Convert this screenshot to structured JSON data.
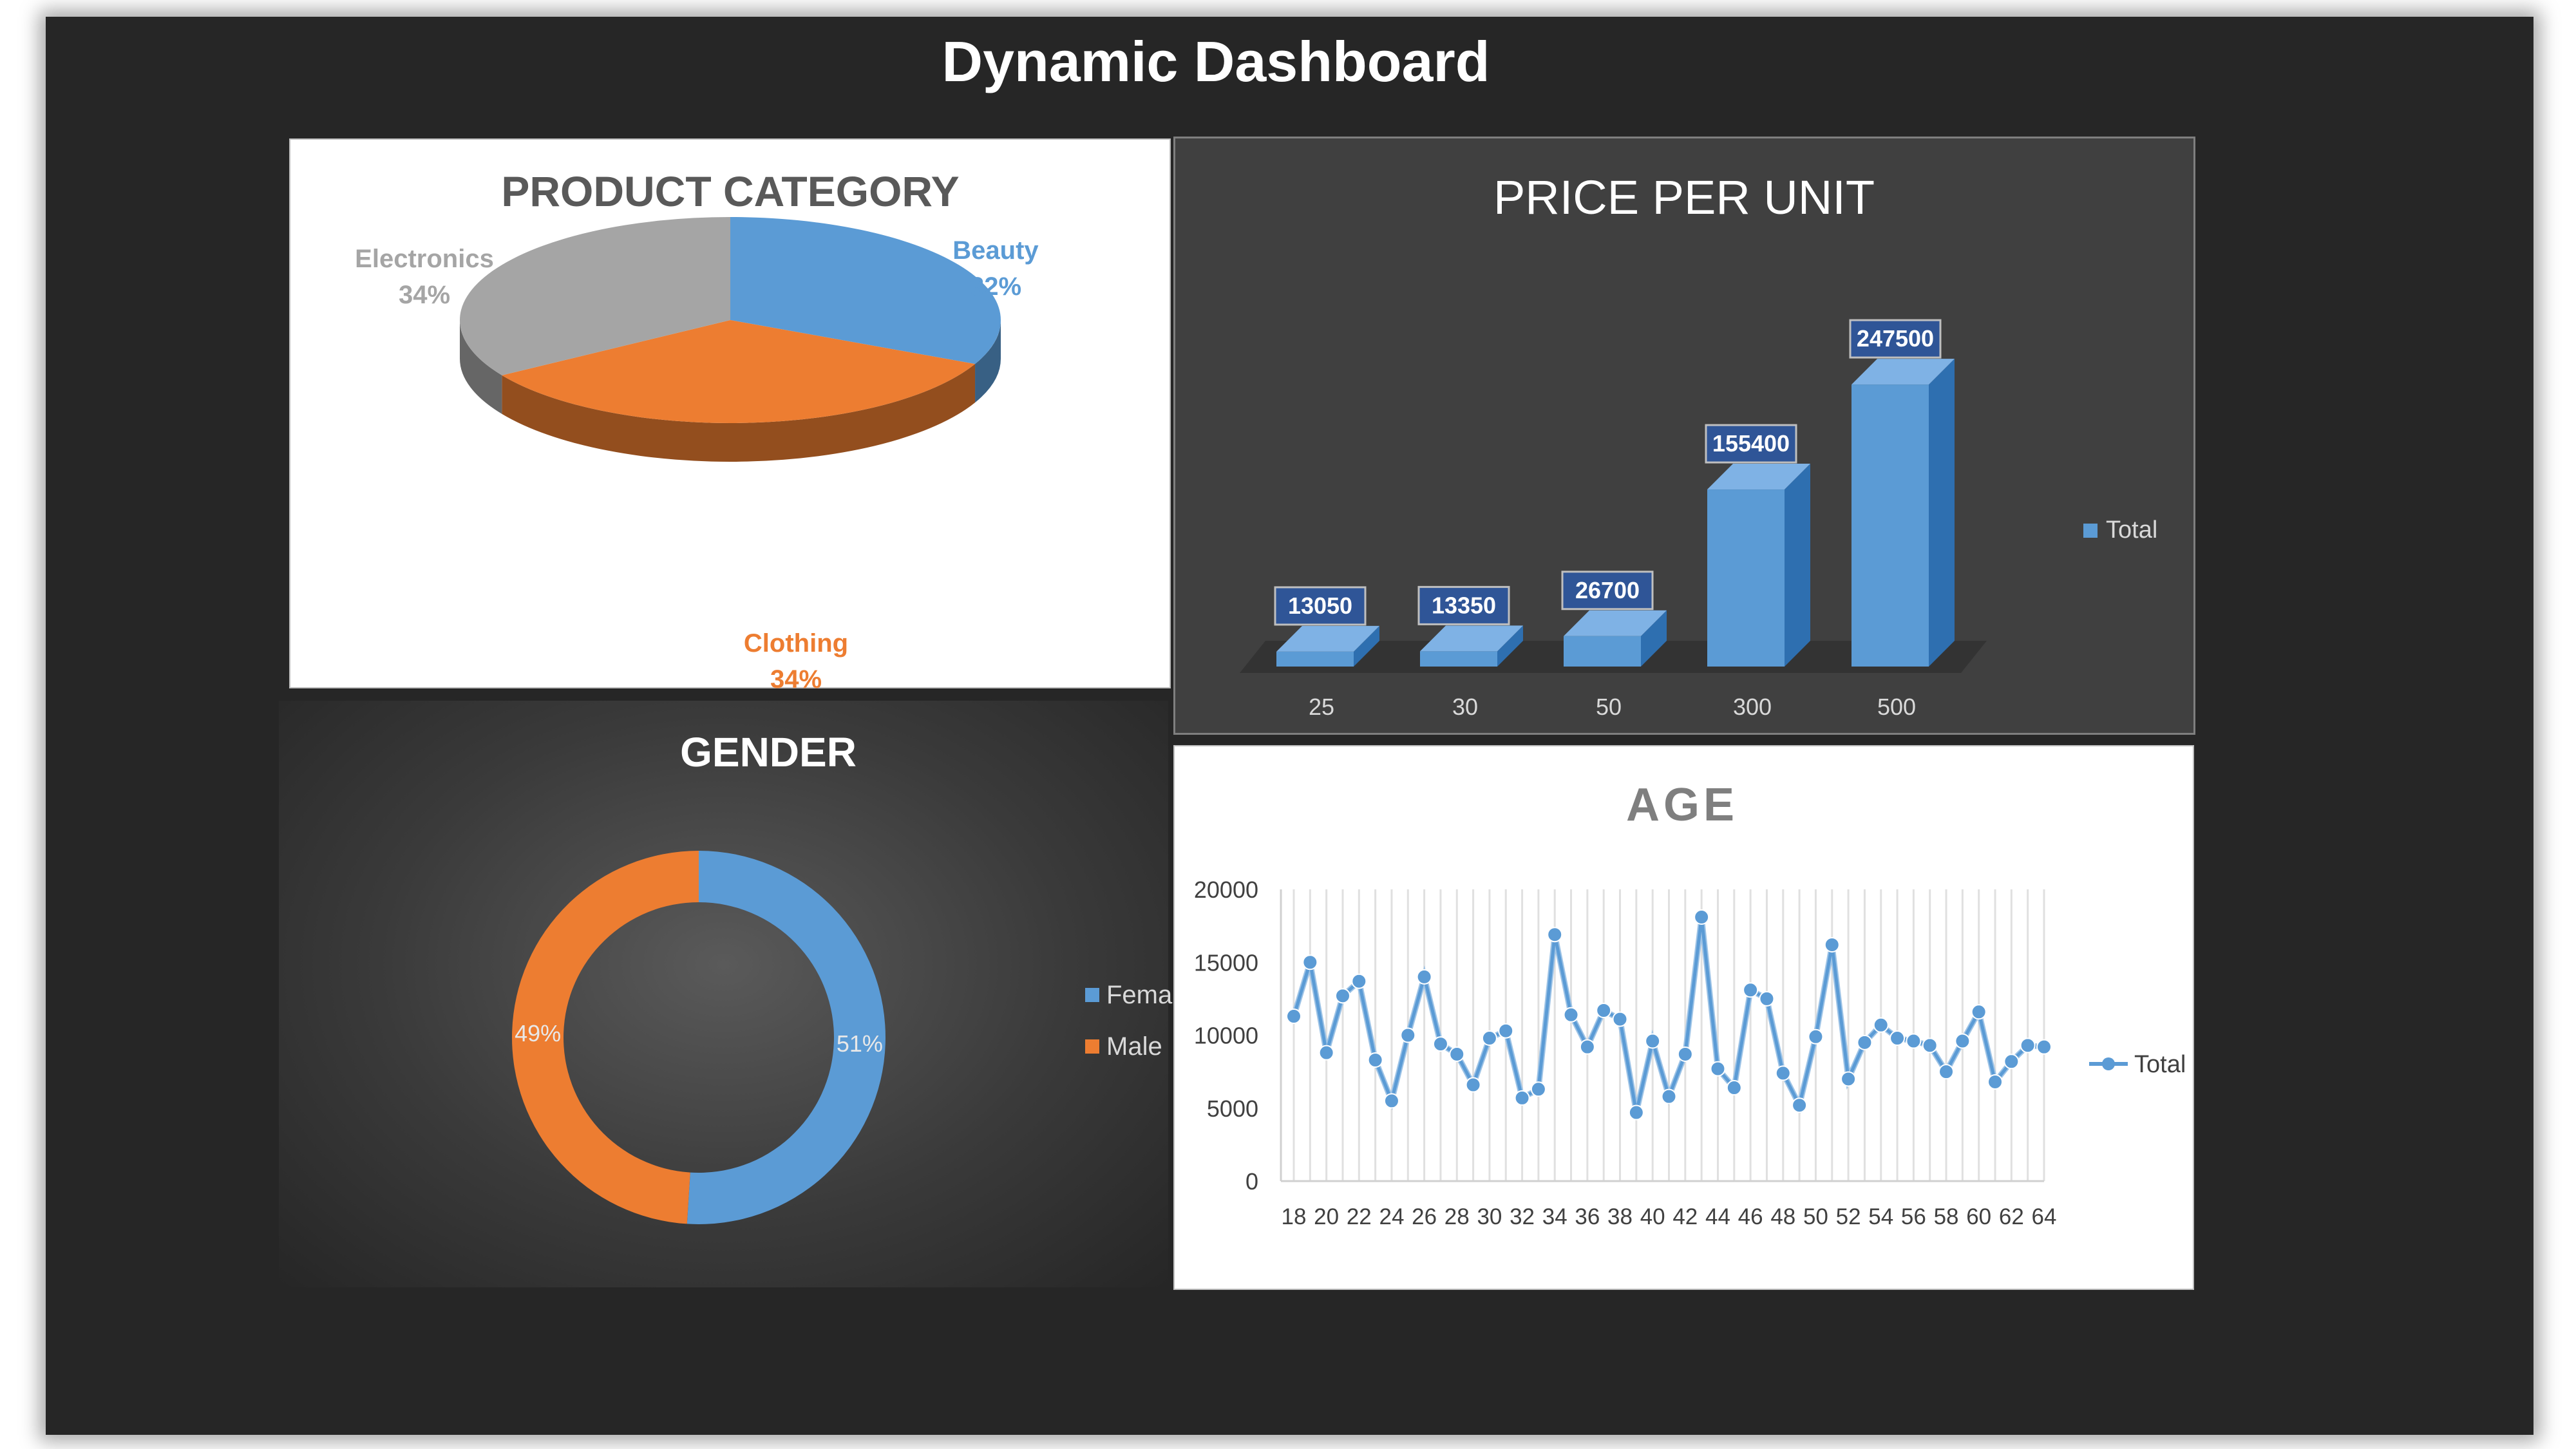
{
  "dashboard": {
    "title": "Dynamic Dashboard"
  },
  "colors": {
    "blue": "#5B9BD5",
    "orange": "#ED7D31",
    "gray": "#A5A5A5",
    "frame": "#262626"
  },
  "product_category": {
    "title": "PRODUCT  CATEGORY"
  },
  "price_per_unit": {
    "title": "PRICE PER UNIT"
  },
  "gender": {
    "title": "GENDER"
  },
  "age": {
    "title": "AGE"
  },
  "chart_data": [
    {
      "type": "pie",
      "title": "PRODUCT  CATEGORY",
      "categories": [
        "Beauty",
        "Clothing",
        "Electronics"
      ],
      "values": [
        32,
        34,
        34
      ],
      "data_labels": [
        "32%",
        "34%",
        "34%"
      ],
      "colors": [
        "#5B9BD5",
        "#ED7D31",
        "#A5A5A5"
      ],
      "style": "3d"
    },
    {
      "type": "bar",
      "title": "PRICE PER UNIT",
      "categories": [
        "25",
        "30",
        "50",
        "300",
        "500"
      ],
      "series": [
        {
          "name": "Total",
          "values": [
            13050,
            13350,
            26700,
            155400,
            247500
          ]
        }
      ],
      "data_labels": [
        "13050",
        "13350",
        "26700",
        "155400",
        "247500"
      ],
      "legend": "right",
      "style": "3d"
    },
    {
      "type": "pie",
      "title": "GENDER",
      "categories": [
        "Female",
        "Male"
      ],
      "values": [
        51,
        49
      ],
      "data_labels": [
        "51%",
        "49%"
      ],
      "colors": [
        "#5B9BD5",
        "#ED7D31"
      ],
      "style": "doughnut",
      "legend": "right"
    },
    {
      "type": "line",
      "title": "AGE",
      "x": [
        18,
        19,
        20,
        21,
        22,
        23,
        24,
        25,
        26,
        27,
        28,
        29,
        30,
        31,
        32,
        33,
        34,
        35,
        36,
        37,
        38,
        39,
        40,
        41,
        42,
        43,
        44,
        45,
        46,
        47,
        48,
        49,
        50,
        51,
        52,
        53,
        54,
        55,
        56,
        57,
        58,
        59,
        60,
        61,
        62,
        63,
        64
      ],
      "x_tick_labels": [
        "18",
        "20",
        "22",
        "24",
        "26",
        "28",
        "30",
        "32",
        "34",
        "36",
        "38",
        "40",
        "42",
        "44",
        "46",
        "48",
        "50",
        "52",
        "54",
        "56",
        "58",
        "60",
        "62",
        "64"
      ],
      "series": [
        {
          "name": "Total",
          "values": [
            11300,
            15000,
            8800,
            12700,
            13700,
            8300,
            5500,
            10000,
            14000,
            9400,
            8700,
            6600,
            9800,
            10300,
            5700,
            6300,
            16900,
            11400,
            9200,
            11700,
            11100,
            4700,
            9600,
            5800,
            8700,
            18100,
            7700,
            6400,
            13100,
            12500,
            7400,
            5200,
            9900,
            16200,
            7000,
            9500,
            10700,
            9800,
            9600,
            9300,
            7500,
            9600,
            11600,
            6800,
            8200,
            9300,
            9200
          ]
        }
      ],
      "y_ticks": [
        "0",
        "5000",
        "10000",
        "15000",
        "20000"
      ],
      "ylim": [
        0,
        20000
      ],
      "grid": true,
      "legend": "right"
    }
  ]
}
